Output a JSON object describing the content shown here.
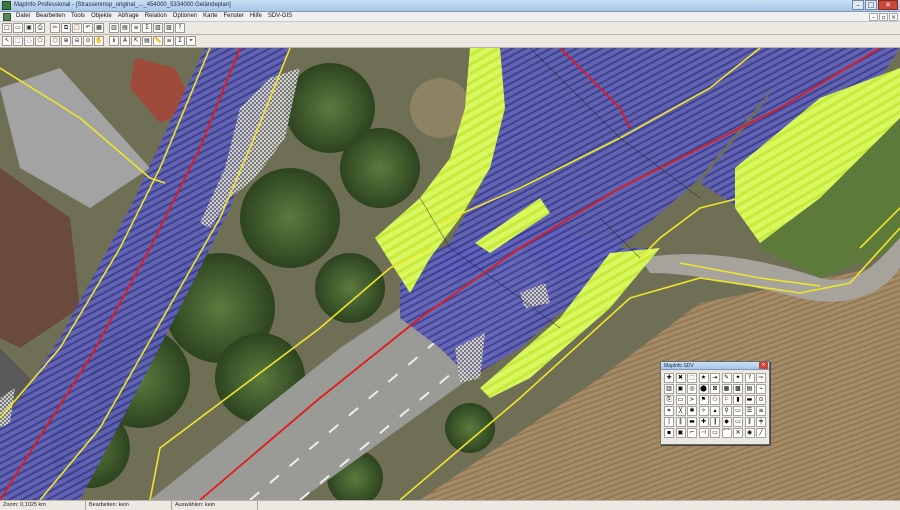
{
  "window": {
    "title": "MapInfo Professional - [Strassenmsp_original_..._454000_5334000 Geländeplan]",
    "minimize": "–",
    "maximize": "□",
    "close": "✕"
  },
  "menu": {
    "items": [
      "Datei",
      "Bearbeiten",
      "Tools",
      "Objekte",
      "Abfrage",
      "Relation",
      "Optionen",
      "Karte",
      "Fenster",
      "Hilfe",
      "SDV-GIS"
    ],
    "mdi_minimize": "–",
    "mdi_restore": "▫",
    "mdi_close": "×"
  },
  "toolbar1": {
    "icons": [
      "new-icon",
      "open-icon",
      "save-icon",
      "print-icon",
      "cut-icon",
      "copy-icon",
      "paste-icon",
      "undo-icon",
      "table-icon",
      "graph-icon",
      "layout-icon",
      "legend-icon",
      "statistics-icon",
      "map-window-icon",
      "browser-icon",
      "help-icon"
    ],
    "glyphs": [
      "□",
      "▭",
      "▣",
      "⎙",
      "✂",
      "⧉",
      "📋",
      "↶",
      "▦",
      "▥",
      "▤",
      "≡",
      "Σ",
      "▧",
      "▨",
      "?"
    ]
  },
  "toolbar2": {
    "icons": [
      "select-icon",
      "marquee-select-icon",
      "radius-select-icon",
      "polygon-select-icon",
      "boundary-select-icon",
      "zoom-in-icon",
      "zoom-out-icon",
      "change-view-icon",
      "grabber-icon",
      "info-icon",
      "label-icon",
      "drag-window-icon",
      "layer-control-icon",
      "ruler-icon",
      "legend-icon",
      "statistics-icon",
      "show-coords-icon"
    ],
    "glyphs": [
      "↖",
      "⬚",
      "◌",
      "⬠",
      "⬡",
      "⊕",
      "⊖",
      "⊙",
      "✋",
      "ℹ",
      "A",
      "⇱",
      "▤",
      "📏",
      "≡",
      "Σ",
      "⌖"
    ]
  },
  "palette": {
    "title": "MapInfo SDV",
    "close": "×",
    "icons": [
      "pal-tool-1",
      "pal-tool-2",
      "pal-tool-3",
      "pal-tool-4",
      "pal-tool-5",
      "pal-tool-6",
      "pal-tool-7",
      "pal-tool-8",
      "pal-tool-9",
      "pal-tool-10",
      "pal-tool-11",
      "pal-tool-12",
      "pal-tool-13",
      "pal-tool-14",
      "pal-tool-15",
      "pal-tool-16",
      "pal-tool-17",
      "pal-tool-18",
      "pal-tool-19",
      "pal-tool-20",
      "pal-tool-21",
      "pal-tool-22",
      "pal-tool-23",
      "pal-tool-24",
      "pal-tool-25",
      "pal-tool-26",
      "pal-tool-27",
      "pal-tool-28",
      "pal-tool-29",
      "pal-tool-30",
      "pal-tool-31",
      "pal-tool-32",
      "pal-tool-33",
      "pal-tool-34",
      "pal-tool-35",
      "pal-tool-36",
      "pal-tool-37",
      "pal-tool-38",
      "pal-tool-39",
      "pal-tool-40",
      "pal-tool-41",
      "pal-tool-42",
      "pal-tool-43",
      "pal-tool-44",
      "pal-tool-45",
      "pal-tool-46",
      "pal-tool-47",
      "pal-tool-48",
      "pal-tool-49",
      "pal-tool-50",
      "pal-tool-51",
      "pal-tool-52",
      "pal-tool-53",
      "pal-tool-54"
    ],
    "glyphs": [
      "✚",
      "✖",
      "⬚",
      "★",
      "⇥",
      "✎",
      "✦",
      "?",
      "⇨",
      "▥",
      "▣",
      "◎",
      "⬤",
      "⊠",
      "▦",
      "▩",
      "▤",
      "⌁",
      "⎘",
      "▭",
      "≻",
      "⚑",
      "⚇",
      "⚐",
      "▮",
      "▬",
      "⊙",
      "⌗",
      "╳",
      "✱",
      "✧",
      "▴",
      "⚲",
      "▭",
      "☰",
      "≡",
      "│",
      "‖",
      "▬",
      "✚",
      "┃",
      "◆",
      "▭",
      "‖",
      "╪",
      "▪",
      "▣",
      "⌐",
      "⊣",
      "▭",
      "⌒",
      "✕",
      "◉",
      "╱"
    ]
  },
  "status": {
    "zoom": "Zoom: 0,1025 km",
    "editable": "Bearbeiten: kein",
    "selectable": "Auswählen: kein",
    "extra": ""
  },
  "colors": {
    "road_hatch": "#5557b8",
    "green_area": "#d6f55a",
    "boundary_line": "#e8e020",
    "centerline": "#e21a1a",
    "field": "#9c8460",
    "vegetation": "#3e5a2c"
  }
}
